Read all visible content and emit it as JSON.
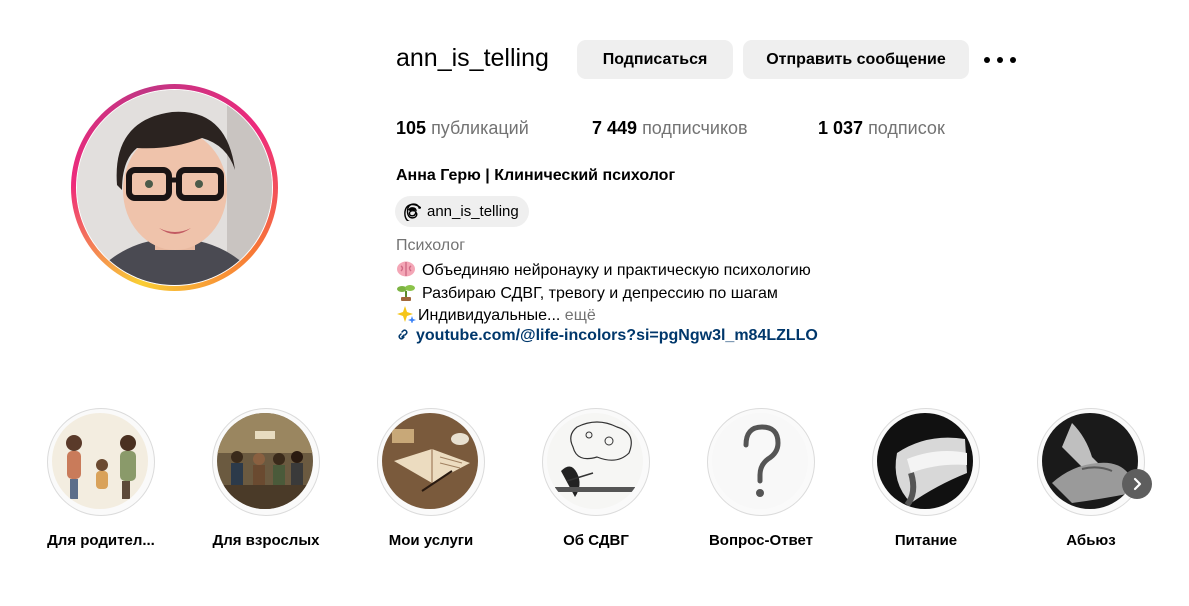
{
  "profile": {
    "username": "ann_is_telling",
    "follow_label": "Подписаться",
    "message_label": "Отправить сообщение",
    "more_icon": "more-horizontal-icon"
  },
  "stats": {
    "posts_count": "105",
    "posts_label": "публикаций",
    "followers_count": "7 449",
    "followers_label": "подписчиков",
    "following_count": "1 037",
    "following_label": "подписок"
  },
  "bio": {
    "full_name": "Анна Герю | Клинический психолог",
    "threads_handle": "ann_is_telling",
    "category": "Психолог",
    "line1": "Объединяю нейронауку и практическую психологию",
    "line2": "Разбираю СДВГ, тревогу и депрессию по шагам",
    "line3": "Индивидуальные...",
    "more_label": "ещё",
    "link": "youtube.com/@life-incolors?si=pgNgw3l_m84LZLLO"
  },
  "highlights": [
    {
      "label": "Для родител..."
    },
    {
      "label": "Для взрослых"
    },
    {
      "label": "Мои услуги"
    },
    {
      "label": "Об СДВГ"
    },
    {
      "label": "Вопрос-Ответ"
    },
    {
      "label": "Питание"
    },
    {
      "label": "Абьюз"
    }
  ],
  "colors": {
    "button_bg": "#efefef",
    "link": "#00376b",
    "secondary_text": "#737373",
    "ring_start": "#f9ce34",
    "ring_mid": "#ee2a7b",
    "ring_end": "#c13584"
  }
}
